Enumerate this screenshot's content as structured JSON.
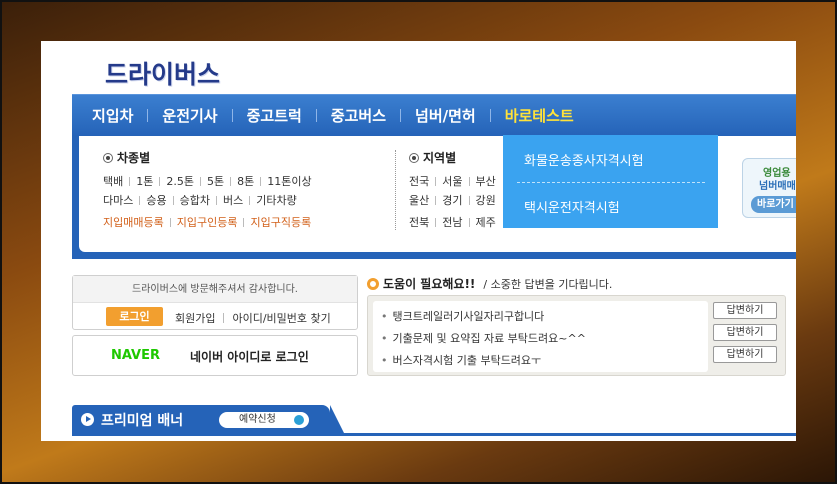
{
  "site": {
    "logo": "드라이버스"
  },
  "nav": {
    "items": [
      "지입차",
      "운전기사",
      "중고트럭",
      "중고버스",
      "넘버/면허",
      "바로테스트"
    ],
    "active_index": 5
  },
  "vehicle_type": {
    "title": "차종별",
    "row1": [
      "택배",
      "1톤",
      "2.5톤",
      "5톤",
      "8톤",
      "11톤이상"
    ],
    "row2": [
      "다마스",
      "승용",
      "승합차",
      "버스",
      "기타차량"
    ],
    "row3": [
      "지입매매등록",
      "지입구인등록",
      "지입구직등록"
    ]
  },
  "region": {
    "title": "지역별",
    "row1": [
      "전국",
      "서울",
      "부산"
    ],
    "row2": [
      "울산",
      "경기",
      "강원"
    ],
    "row3": [
      "전북",
      "전남",
      "제주"
    ]
  },
  "dropdown": {
    "items": [
      "화물운송종사자격시험",
      "택시운전자격시험"
    ]
  },
  "side_ad": {
    "line1": "영업용",
    "line2": "넘버매매",
    "button": "바로가기"
  },
  "login": {
    "greeting": "드라이버스에 방문해주셔서 감사합니다.",
    "login_button": "로그인",
    "signup": "회원가입",
    "find": "아이디/비밀번호 찾기"
  },
  "naver": {
    "logo": "NAVER",
    "text": "네이버 아이디로 로그인"
  },
  "help": {
    "title": "도움이 필요해요!!",
    "subtitle": "/ 소중한 답변을 기다립니다.",
    "items": [
      "탱크트레일러기사일자리구합니다",
      "기출문제 및 요약집 자료 부탁드려요~^^",
      "버스자격시험 기출 부탁드려요ㅜ"
    ],
    "reply_label": "답변하기"
  },
  "premium": {
    "label": "프리미엄 배너",
    "reserve": "예약신청"
  },
  "colors": {
    "nav_blue": "#2563b8",
    "dropdown_blue": "#3aa3f0",
    "active_yellow": "#ffe23a",
    "orange": "#f29f2f"
  }
}
